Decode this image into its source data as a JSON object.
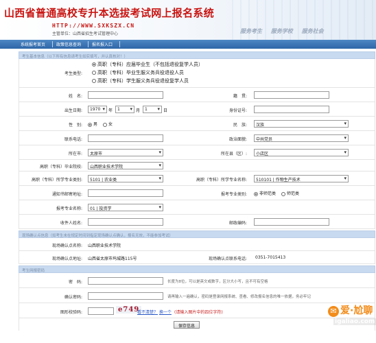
{
  "header": {
    "title": "山西省普通高校专升本选拔考试网上报名系统",
    "url": "HTTP://WWW.SXKSZX.CN",
    "host": "主管单位：山西省招生考试管理中心",
    "slogans": [
      "服务考生",
      "服务学校",
      "服务社会"
    ]
  },
  "nav": {
    "items": [
      "系统报考首页",
      "政策信息查询",
      "报名报入口"
    ]
  },
  "sections": {
    "basic": "考生基本信息（以下所有信息请考生如实填写，并认真核对！）",
    "confirm": "现场确认点信息（如考生未在规定时间到指定现场确认点确认，报名无效，不能参加考试）",
    "password": "考生网报密码"
  },
  "exam_type": {
    "label": "考生类型:",
    "options": [
      "高职（专科）应届毕业生（不包括退役复学人员）",
      "高职（专科）毕业生服义务兵役退役人员",
      "高职（专科）学生服义务兵役退役复学人员"
    ],
    "selected_index": 0
  },
  "form": {
    "name_label": "姓　名:",
    "native_label": "籍　贯:",
    "birth_label": "出生日期:",
    "birth_year": "1970",
    "birth_month": "1",
    "birth_day": "1",
    "year_unit": "年",
    "month_unit": "月",
    "day_unit": "日",
    "id_label": "身份证号:",
    "gender_label": "性　别:",
    "gender_male": "男",
    "gender_female": "女",
    "nation_label": "民　族:",
    "nation_value": "汉族",
    "phone_label": "联系电话:",
    "politics_label": "政治面貌:",
    "politics_value": "中共党员",
    "city_label": "所在市:",
    "city_value": "太原市",
    "county_label": "所在县（区）:",
    "county_value": "小店区",
    "school_label": "高职（专科）毕业院校:",
    "school_value": "山西职业技术学院",
    "major_cat_label": "高职（专科）所学专业类别:",
    "major_cat_value": "5101 | 农业类",
    "major_name_label": "高职（专科）所学专业名称:",
    "major_name_value": "510101 | 作物生产技术",
    "address_label": "通知书邮寄地址:",
    "apply_cat_label": "报考专业类别:",
    "apply_cat_normal": "非师范类",
    "apply_cat_teacher": "师范类",
    "apply_major_label": "报考专业名称:",
    "apply_major_value": "01 | 投资学",
    "receiver_label": "收件人姓名:",
    "zip_label": "邮政编码:"
  },
  "confirm": {
    "point_label": "现场确认点名称:",
    "point_value": "山西职业技术学院",
    "addr_label": "现场确认点地址:",
    "addr_value": "山西省太原市坞城路115号",
    "tel_label": "现场确认点联系电话:",
    "tel_value": "0351-7015413"
  },
  "password": {
    "pwd_label": "密　码:",
    "pwd_hint": "长度为8位，可以是英文或数字，区分大小写，且不可有空格",
    "confirm_label": "确认密码:",
    "confirm_hint": "请再输入一遍确认，密码是登录网报系统、查看、修改报名信息的唯一依据，务必牢记",
    "captcha_label": "图形校验码:",
    "captcha_value": "e749",
    "captcha_link1": "看不清楚？",
    "captcha_link2": "换一个",
    "captcha_hint": "(请输入图片中的四位字符)"
  },
  "save_button": "保存信息",
  "watermark": {
    "logo": "爱·尬聊",
    "domain": "igaliao.com"
  }
}
